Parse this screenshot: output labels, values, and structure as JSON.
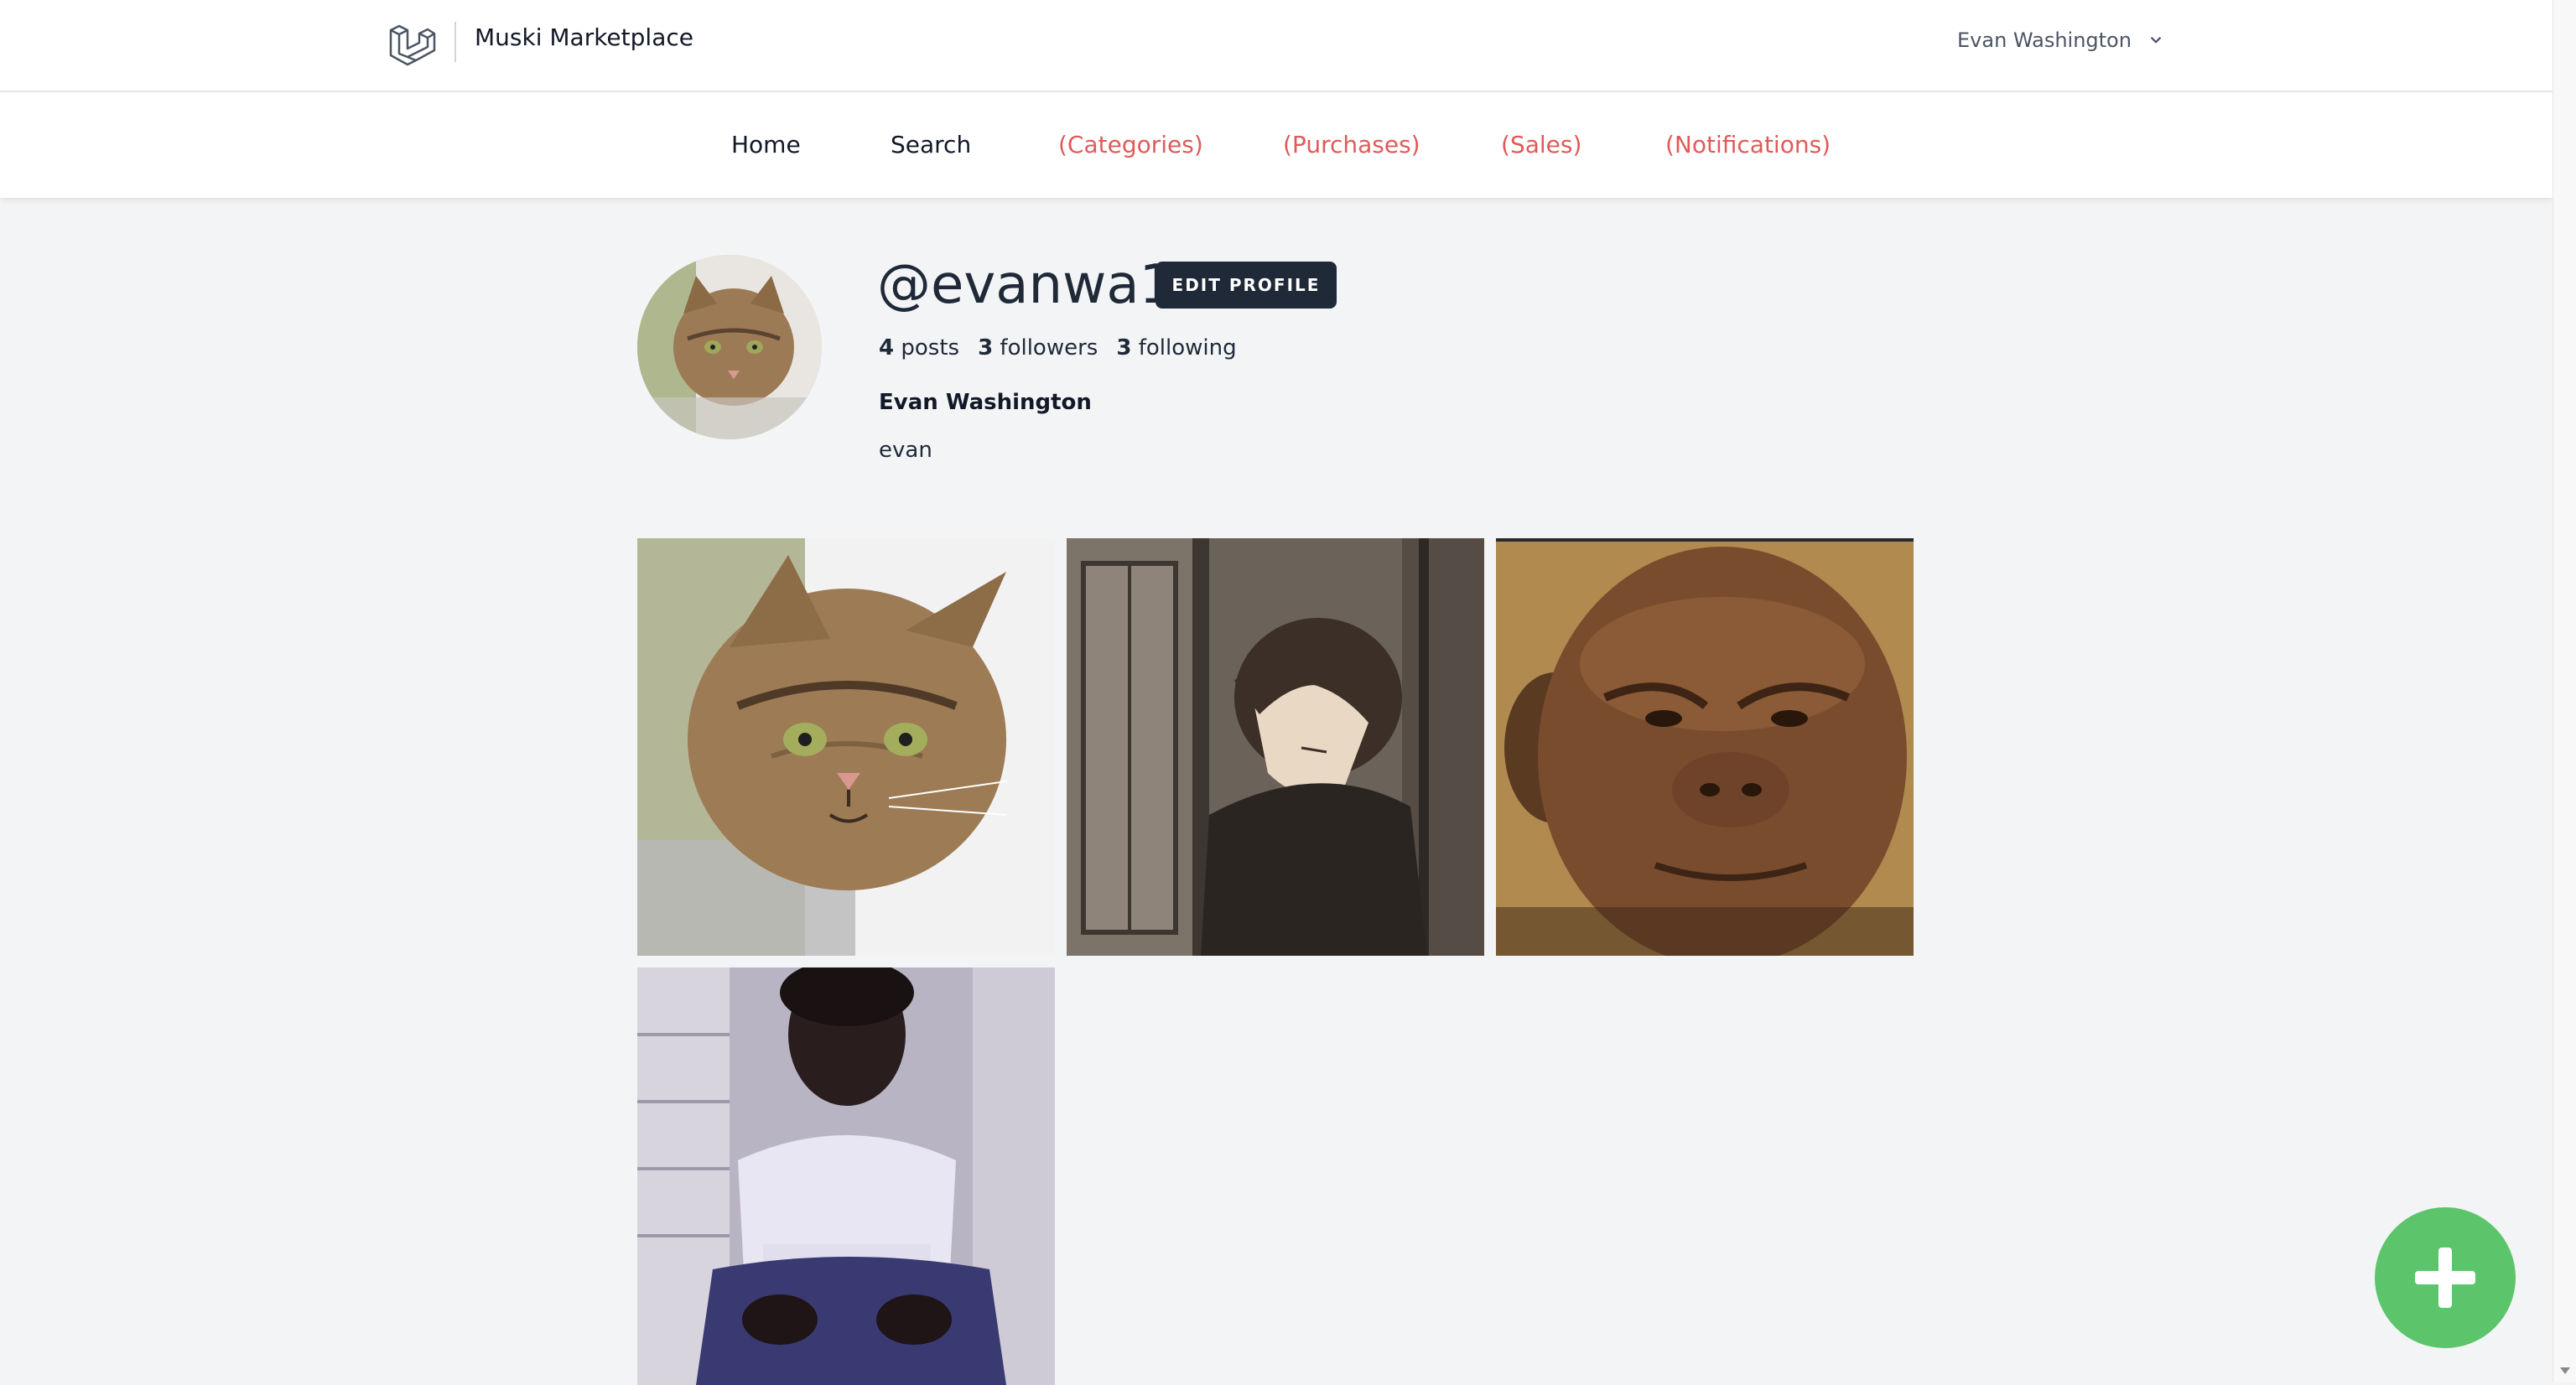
{
  "app": {
    "name": "Muski Marketplace"
  },
  "user_menu": {
    "name": "Evan Washington"
  },
  "nav": {
    "home": "Home",
    "search": "Search",
    "categories": "(Categories)",
    "purchases": "(Purchases)",
    "sales": "(Sales)",
    "notifications": "(Notifications)"
  },
  "profile": {
    "handle": "@evanwa1",
    "edit_label": "EDIT PROFILE",
    "posts_count": "4",
    "posts_label": "posts",
    "followers_count": "3",
    "followers_label": "followers",
    "following_count": "3",
    "following_label": "following",
    "full_name": "Evan Washington",
    "bio": "evan"
  },
  "colors": {
    "nav_muted": "#e05a5a",
    "button_dark": "#1f2937",
    "fab": "#5cc46a"
  },
  "icons": {
    "logo": "laravel-logo-icon",
    "dropdown": "chevron-down-icon",
    "fab": "plus-icon"
  }
}
